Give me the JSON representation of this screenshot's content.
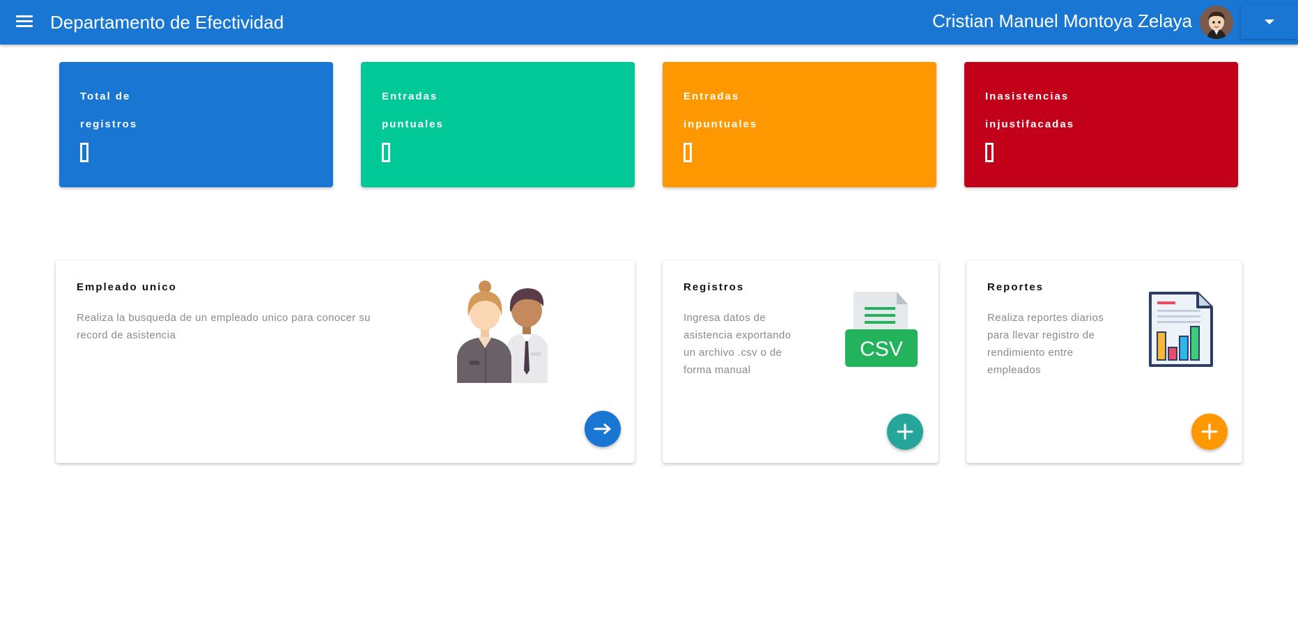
{
  "header": {
    "title": "Departamento de Efectividad",
    "user_name": "Cristian Manuel Montoya Zelaya",
    "menu_icon": "menu-icon",
    "dropdown_icon": "arrow-drop-down-icon"
  },
  "stats": [
    {
      "line1": "Total de",
      "line2": "registros",
      "color": "#1976d2"
    },
    {
      "line1": "Entradas",
      "line2": "puntuales",
      "color": "#00c896"
    },
    {
      "line1": "Entradas",
      "line2": "inpuntuales",
      "color": "#ff9800"
    },
    {
      "line1": "Inasistencias",
      "line2": "injustifacadas",
      "color": "#c30019"
    }
  ],
  "cards": {
    "empleado": {
      "title": "Empleado unico",
      "desc_line1": "Realiza la busqueda de un empleado unico para conocer su",
      "desc_line2": "record de asistencia",
      "illustration": "employees-illustration",
      "button_icon": "arrow-right-icon",
      "button_color": "#1976d2"
    },
    "registros": {
      "title": "Registros",
      "desc_lines": [
        "Ingresa datos de",
        "asistencia exportando",
        "un archivo .csv o de",
        "forma manual"
      ],
      "badge": "CSV",
      "illustration": "csv-file-icon",
      "button_icon": "plus-icon",
      "button_color": "#26a69a"
    },
    "reportes": {
      "title": "Reportes",
      "desc_lines": [
        "Realiza reportes diarios",
        "para llevar registro de",
        "rendimiento entre",
        "empleados"
      ],
      "illustration": "report-chart-icon",
      "button_icon": "plus-icon",
      "button_color": "#ff9800"
    }
  }
}
